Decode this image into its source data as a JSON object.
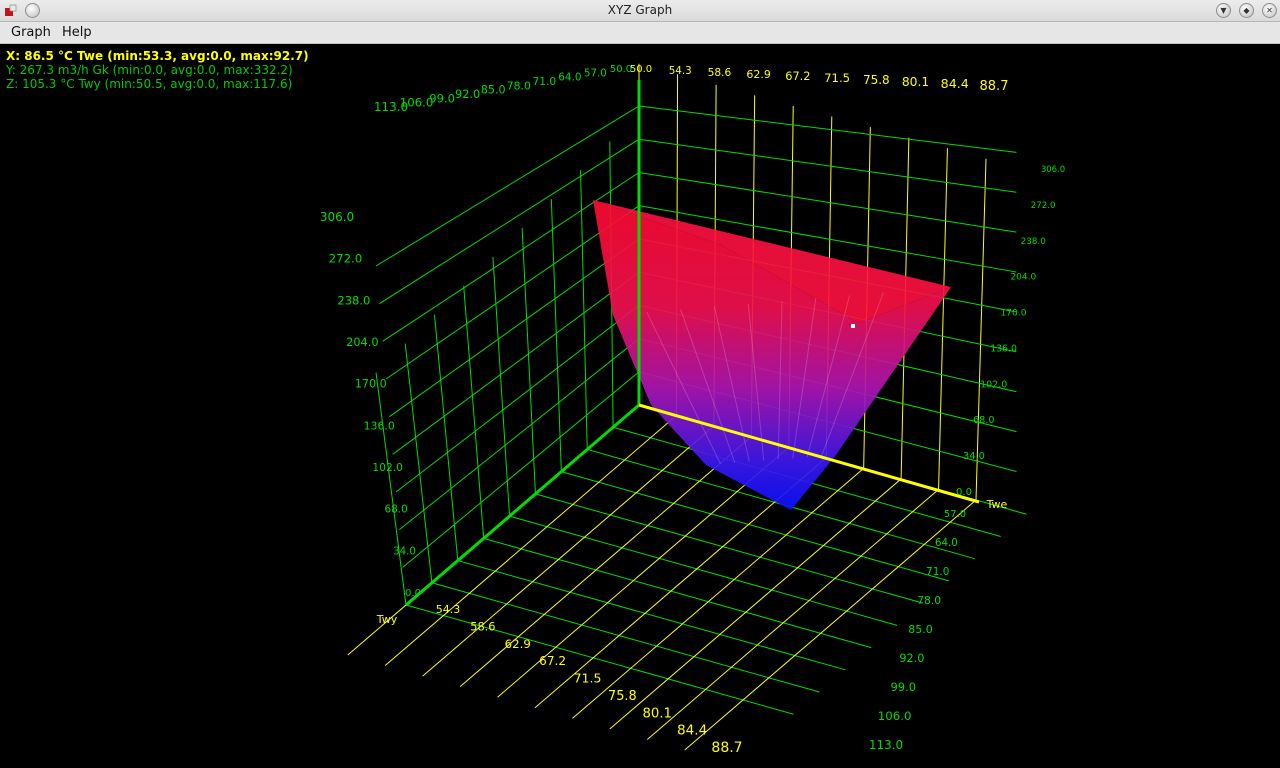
{
  "window": {
    "title": "XYZ Graph",
    "icons": {
      "app": "app-icon",
      "minimize": "minimize-icon",
      "maximize": "maximize-icon",
      "close": "close-icon"
    }
  },
  "menu": {
    "items": [
      "Graph",
      "Help"
    ]
  },
  "readout": {
    "x": "X: 86.5 °C Twe (min:53.3, avg:0.0, max:92.7)",
    "y": "Y: 267.3 m3/h Gk (min:0.0, avg:0.0, max:332.2)",
    "z": "Z: 105.3 °C Twy (min:50.5, avg:0.0, max:117.6)"
  },
  "axes": {
    "x_name": "Twe",
    "z_name": "Twy",
    "x_ticks": [
      "50.0",
      "54.3",
      "58.6",
      "62.9",
      "67.2",
      "71.5",
      "75.8",
      "80.1",
      "84.4",
      "88.7"
    ],
    "z_ticks": [
      "50.0",
      "57.0",
      "64.0",
      "71.0",
      "78.0",
      "85.0",
      "92.0",
      "99.0",
      "106.0",
      "113.0"
    ],
    "y_ticks": [
      "0.0",
      "34.0",
      "68.0",
      "102.0",
      "136.0",
      "170.0",
      "204.0",
      "238.0",
      "272.0",
      "306.0"
    ]
  },
  "colors": {
    "background": "#000000",
    "grid": "#00dd00",
    "x_grid": "#ffff00",
    "surface_high": "#ff1030",
    "surface_low": "#1010ff",
    "readout_x": "#ffff00",
    "readout_yz": "#00cc00"
  }
}
